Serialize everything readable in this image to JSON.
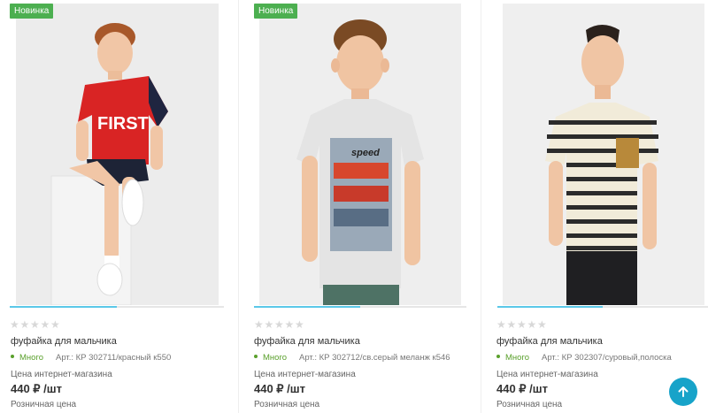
{
  "products": [
    {
      "badge": "Новинка",
      "rating": 0,
      "title": "фуфайка для мальчика",
      "stock": "Много",
      "sku": "Арт.: КР 302711/красный к550",
      "price_label": "Цена интернет-магазина",
      "price": "440 ₽ /шт",
      "retail_label": "Розничная цена",
      "gallery_progress": 0.5
    },
    {
      "badge": "Новинка",
      "rating": 0,
      "title": "фуфайка для мальчика",
      "stock": "Много",
      "sku": "Арт.: КР 302712/св.серый меланж к546",
      "price_label": "Цена интернет-магазина",
      "price": "440 ₽ /шт",
      "retail_label": "Розничная цена",
      "gallery_progress": 0.5
    },
    {
      "rating": 0,
      "title": "фуфайка для мальчика",
      "stock": "Много",
      "sku": "Арт.: КР 302307/суровый,полоска",
      "price_label": "Цена интернет-магазина",
      "price": "440 ₽ /шт",
      "retail_label": "Розничная цена",
      "gallery_progress": 0.5
    }
  ],
  "colors": {
    "badge": "#4caf50",
    "in_stock": "#5aa02c",
    "accent": "#17a3c9",
    "gallery_bar": "#5bc8e8"
  },
  "icons": {
    "star": "star-icon",
    "scroll_top": "arrow-up-icon"
  }
}
